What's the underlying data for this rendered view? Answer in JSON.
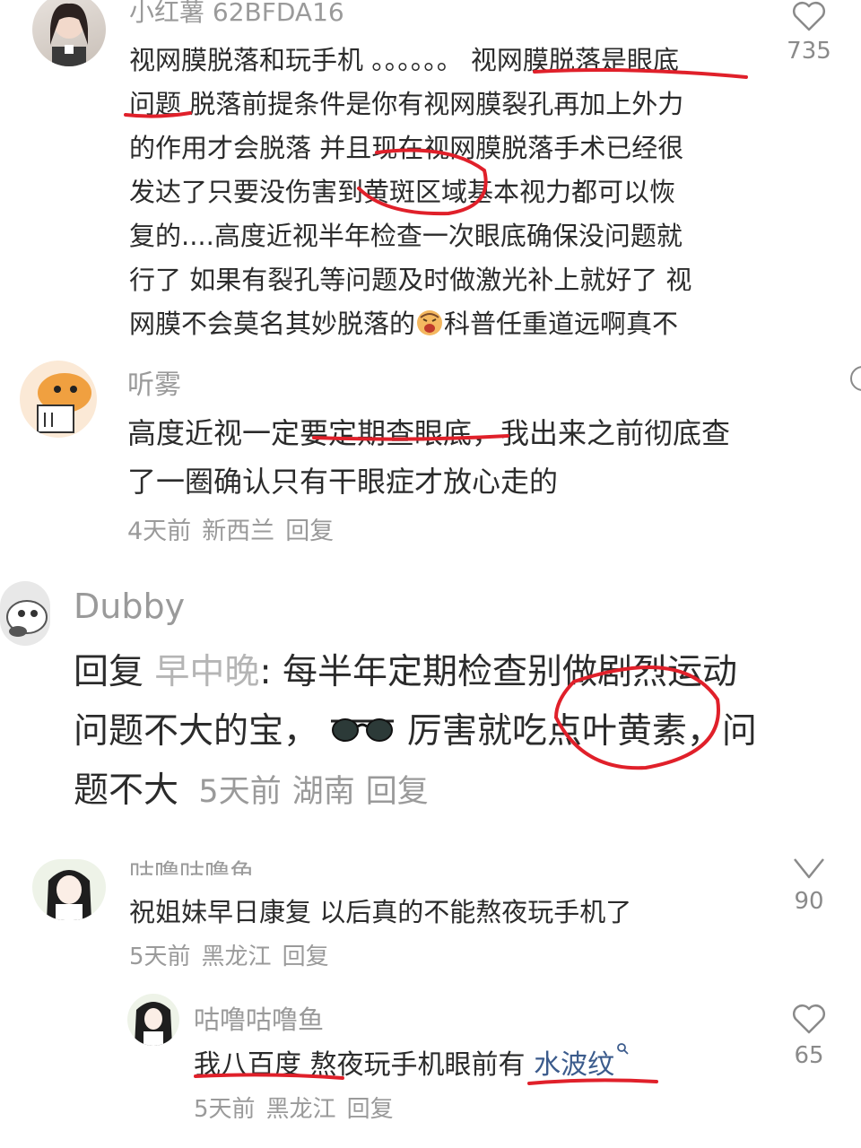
{
  "comments": [
    {
      "user": "小红薯 62BFDA16",
      "lines": [
        "视网膜脱落和玩手机 。。。。。。 视网膜脱落是眼底",
        "问题 脱落前提条件是你有视网膜裂孔再加上外力",
        "的作用才会脱落 并且现在视网膜脱落手术已经很",
        "发达了只要没伤害到黄斑区域基本视力都可以恢",
        "复的....高度近视半年检查一次眼底确保没问题就",
        "行了 如果有裂孔等问题及时做激光补上就好了 视",
        "网膜不会莫名其妙脱落的",
        "科普任重道远啊真不"
      ],
      "likes": "735"
    },
    {
      "user": "听雾",
      "lines": [
        "高度近视一定要定期查眼底，我出来之前彻底查",
        "了一圈确认只有干眼症才放心走的"
      ],
      "time": "4天前",
      "location": "新西兰",
      "reply": "回复"
    },
    {
      "user": "Dubby",
      "reply_prefix": "回复",
      "reply_to": "早中晚",
      "lines": [
        ": 每半年定期检查别做剧烈运动",
        "问题不大的宝，",
        "厉害就吃点叶黄素，问",
        "题不大"
      ],
      "time": "5天前",
      "location": "湖南",
      "reply": "回复"
    },
    {
      "user": "咕噜咕噜鱼",
      "lines": [
        "祝姐妹早日康复 以后真的不能熬夜玩手机了"
      ],
      "time": "5天前",
      "location": "黑龙江",
      "reply": "回复",
      "likes": "90"
    },
    {
      "user": "咕噜咕噜鱼",
      "lines": [
        "我八百度 熬夜玩手机眼前有",
        "水波纹"
      ],
      "time": "5天前",
      "location": "黑龙江",
      "reply": "回复",
      "likes": "65"
    }
  ],
  "colors": {
    "annotation": "#e0202a",
    "link": "#3b5b8c",
    "muted": "#9a9a9a"
  }
}
